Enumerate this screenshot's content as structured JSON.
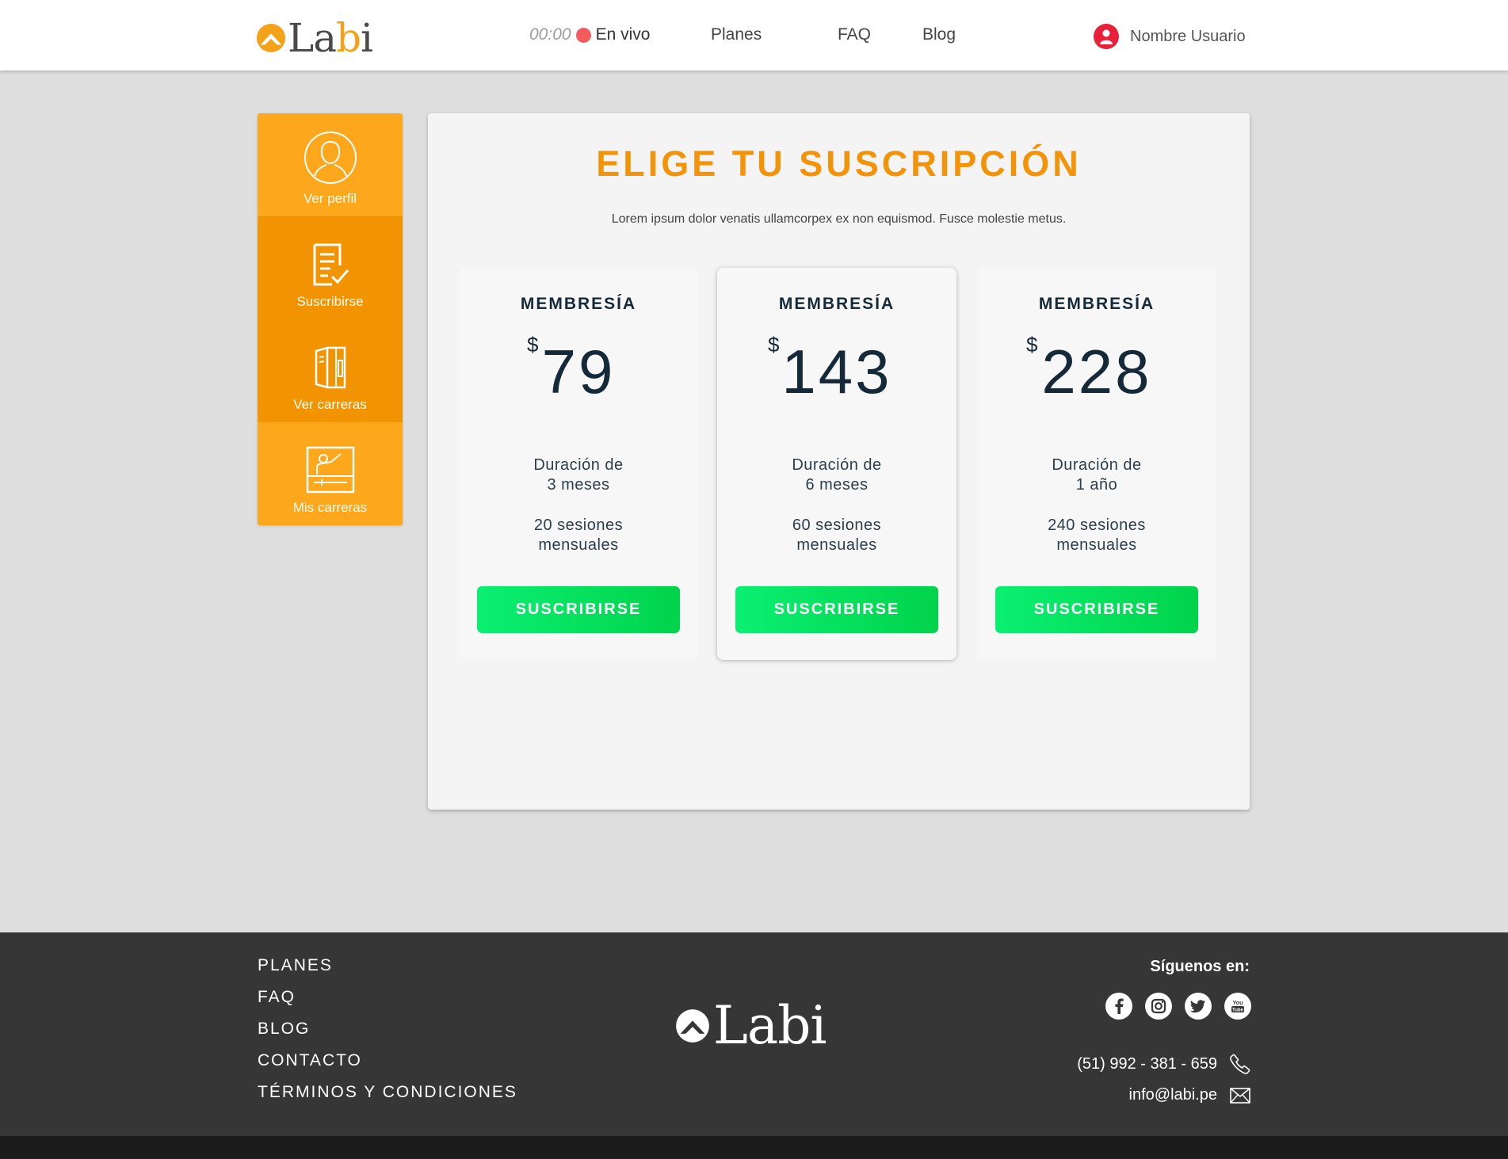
{
  "header": {
    "logo_text": "Labi",
    "live_time": "00:00",
    "live_label": "En vivo",
    "nav": [
      "Planes",
      "FAQ",
      "Blog"
    ],
    "user_name": "Nombre Usuario"
  },
  "sidebar": {
    "items": [
      {
        "label": "Ver perfil",
        "icon": "user-circle-icon"
      },
      {
        "label": "Suscribirse",
        "icon": "document-check-icon"
      },
      {
        "label": "Ver carreras",
        "icon": "brochure-icon"
      },
      {
        "label": "Mis carreras",
        "icon": "classroom-board-icon"
      }
    ]
  },
  "main": {
    "title": "ELIGE TU SUSCRIPCIÓN",
    "subtitle": "Lorem ipsum dolor venatis ullamcorpex ex non equismod. Fusce molestie metus.",
    "plans": [
      {
        "name": "MEMBRESÍA",
        "currency": "$",
        "price": "79",
        "duration_1": "Duración de",
        "duration_2": "3 meses",
        "sessions_1": "20 sesiones",
        "sessions_2": "mensuales",
        "button": "SUSCRIBIRSE"
      },
      {
        "name": "MEMBRESÍA",
        "currency": "$",
        "price": "143",
        "duration_1": "Duración de",
        "duration_2": "6 meses",
        "sessions_1": "60 sesiones",
        "sessions_2": "mensuales",
        "button": "SUSCRIBIRSE"
      },
      {
        "name": "MEMBRESÍA",
        "currency": "$",
        "price": "228",
        "duration_1": "Duración de",
        "duration_2": "1 año",
        "sessions_1": "240 sesiones",
        "sessions_2": "mensuales",
        "button": "SUSCRIBIRSE"
      }
    ]
  },
  "footer": {
    "links": [
      "PLANES",
      "FAQ",
      "BLOG",
      "CONTACTO",
      "TÉRMINOS Y CONDICIONES"
    ],
    "logo_text": "Labi",
    "follow_label": "Síguenos en:",
    "socials": [
      "facebook-icon",
      "instagram-icon",
      "twitter-icon",
      "youtube-icon"
    ],
    "phone": "(51) 992 - 381 - 659",
    "email": "info@labi.pe"
  },
  "colors": {
    "brand_orange": "#f39408",
    "sidebar_light": "#fca71c",
    "sidebar_dark": "#f29302",
    "button_green": "#01d34a",
    "live_red": "#f45b5b",
    "footer_bg": "#363636"
  }
}
